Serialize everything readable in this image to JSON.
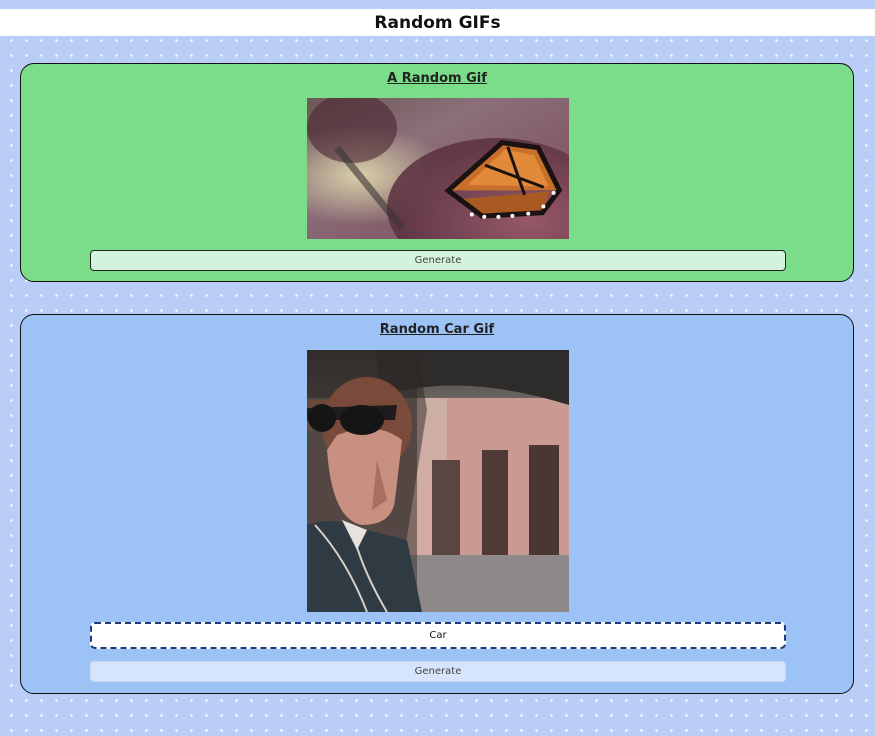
{
  "header": {
    "title": "Random GIFs"
  },
  "random_card": {
    "title": "A Random Gif",
    "image_icon": "butterfly-gif-image",
    "generate_label": "Generate"
  },
  "car_card": {
    "title": "Random Car Gif",
    "image_icon": "car-driver-gif-image",
    "input_value": "Car",
    "generate_label": "Generate"
  },
  "colors": {
    "page_background": "#b9cdf6",
    "random_card_background": "#7bdc8a",
    "car_card_background": "#9dc3f6",
    "header_background": "#ffffff"
  }
}
